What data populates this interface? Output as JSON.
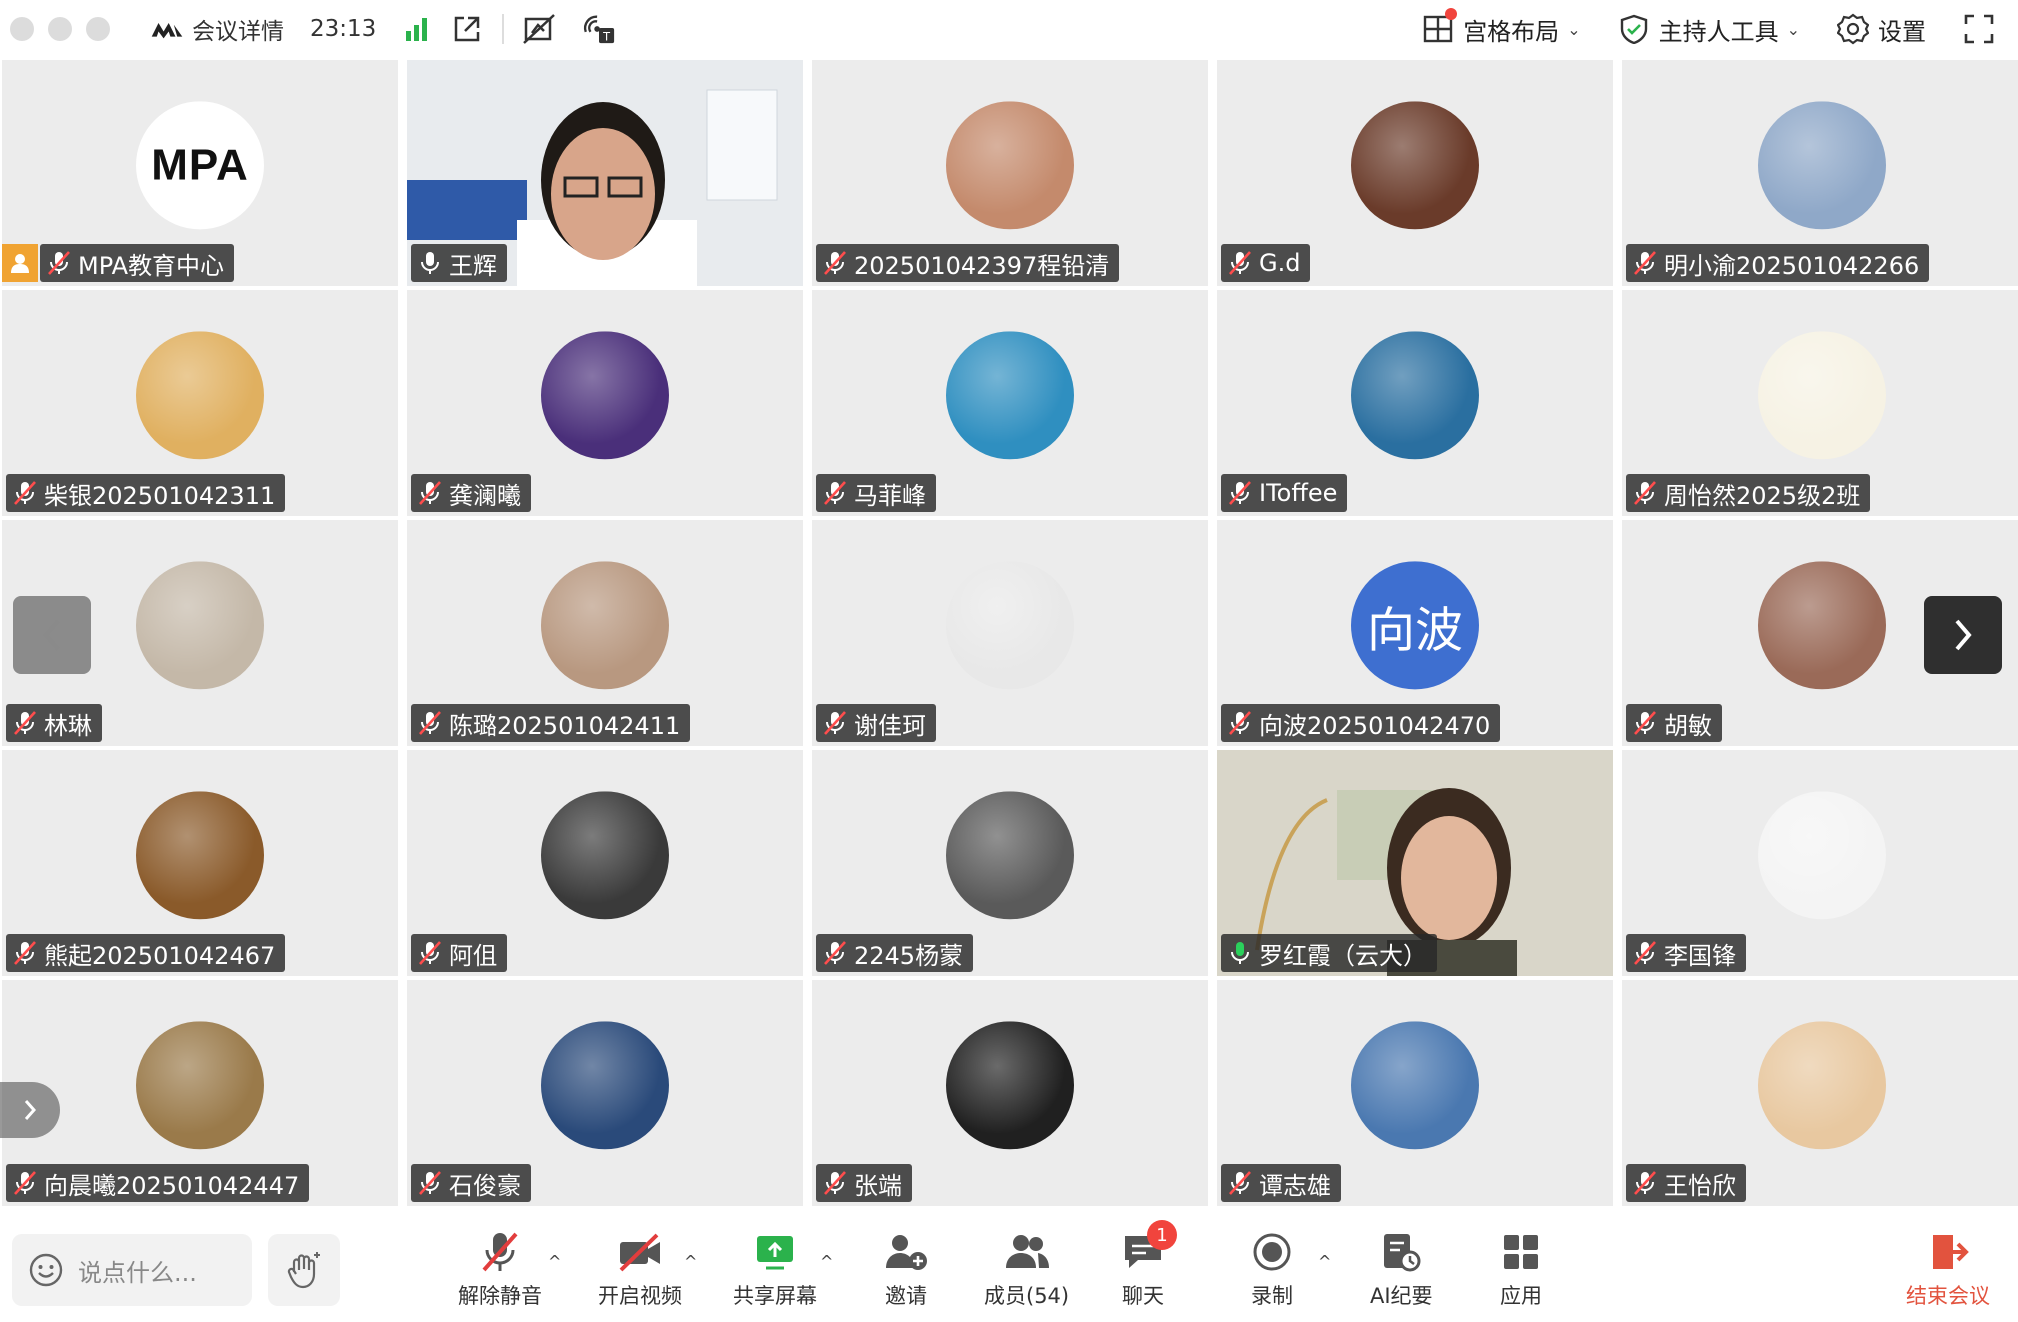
{
  "topbar": {
    "app_title": "会议详情",
    "time": "23:13",
    "gallery_layout": "宫格布局",
    "host_tools": "主持人工具",
    "settings": "设置"
  },
  "participants": [
    {
      "name": "MPA教育中心",
      "avatar": "logo",
      "avatar_text": "MPA",
      "host": true,
      "muted": true
    },
    {
      "name": "王辉",
      "avatar": "video",
      "muted": false
    },
    {
      "name": "202501042397程铅清",
      "avatar": "photo",
      "color": "#c48a6c",
      "muted": true
    },
    {
      "name": "G.d",
      "avatar": "photo",
      "color": "#6a3b2a",
      "muted": true
    },
    {
      "name": "明小渝202501042266",
      "avatar": "photo",
      "color": "#8fa8c8",
      "muted": true
    },
    {
      "name": "柴银202501042311",
      "avatar": "photo",
      "color": "#e0b060",
      "muted": true
    },
    {
      "name": "龚澜曦",
      "avatar": "photo",
      "color": "#4a2f7a",
      "muted": true
    },
    {
      "name": "马菲峰",
      "avatar": "photo",
      "color": "#2f8fc0",
      "muted": true
    },
    {
      "name": "IToffee",
      "avatar": "photo",
      "color": "#2a6fa0",
      "muted": true
    },
    {
      "name": "周怡然2025级2班",
      "avatar": "photo",
      "color": "#f6f2e4",
      "muted": true
    },
    {
      "name": "林琳",
      "avatar": "photo",
      "color": "#c4b8a8",
      "muted": true
    },
    {
      "name": "陈璐202501042411",
      "avatar": "photo",
      "color": "#b89880",
      "muted": true
    },
    {
      "name": "谢佳珂",
      "avatar": "photo",
      "color": "#e8e8e8",
      "muted": true
    },
    {
      "name": "向波202501042470",
      "avatar": "text",
      "avatar_text": "向波",
      "muted": true
    },
    {
      "name": "胡敏",
      "avatar": "photo",
      "color": "#9a6a58",
      "muted": true
    },
    {
      "name": "熊起202501042467",
      "avatar": "photo",
      "color": "#8a5a2a",
      "muted": true
    },
    {
      "name": "阿伹",
      "avatar": "photo",
      "color": "#3a3a3a",
      "muted": true
    },
    {
      "name": "2245杨蒙",
      "avatar": "photo",
      "color": "#5a5a5a",
      "muted": true
    },
    {
      "name": "罗红霞（云大）",
      "avatar": "video",
      "muted": false,
      "speaking": true
    },
    {
      "name": "李国锋",
      "avatar": "photo",
      "color": "#f4f4f4",
      "muted": true
    },
    {
      "name": "向晨曦202501042447",
      "avatar": "photo",
      "color": "#9a7a4a",
      "muted": true
    },
    {
      "name": "石俊豪",
      "avatar": "photo",
      "color": "#2a4a7a",
      "muted": true
    },
    {
      "name": "张端",
      "avatar": "photo",
      "color": "#202020",
      "muted": true
    },
    {
      "name": "谭志雄",
      "avatar": "photo",
      "color": "#4a78b0",
      "muted": true
    },
    {
      "name": "王怡欣",
      "avatar": "photo",
      "color": "#e8c8a0",
      "muted": true
    }
  ],
  "toolbar": {
    "chat_placeholder": "说点什么...",
    "unmute": "解除静音",
    "start_video": "开启视频",
    "share_screen": "共享屏幕",
    "invite": "邀请",
    "members": "成员(54)",
    "chat": "聊天",
    "chat_badge": "1",
    "record": "录制",
    "ai_minutes": "AI纪要",
    "apps": "应用",
    "end_meeting": "结束会议"
  }
}
